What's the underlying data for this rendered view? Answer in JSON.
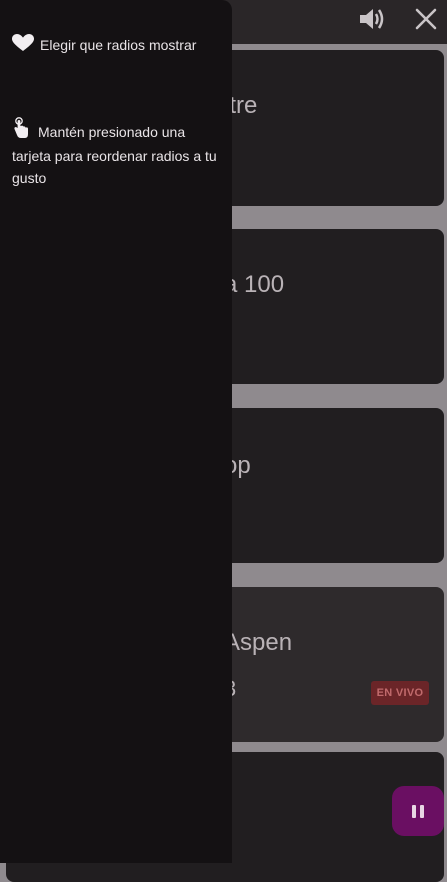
{
  "topbar": {
    "volume_icon": "volume-up-icon",
    "close_icon": "close-icon"
  },
  "cards": [
    {
      "title": "itre"
    },
    {
      "title": "a 100"
    },
    {
      "title": "op"
    },
    {
      "title": "Aspen",
      "subtitle": "3",
      "badge": "EN VIVO"
    },
    {
      "title": ""
    }
  ],
  "player": {
    "pause_icon": "pause-icon"
  },
  "drawer": {
    "items": [
      {
        "icon": "heart-icon",
        "label": "Elegir que radios mostrar"
      },
      {
        "icon": "touch-hand-icon",
        "label": "Mantén presionado una tarjeta para reordenar radios a tu gusto"
      }
    ]
  },
  "colors": {
    "accent": "#6a0f62",
    "live_badge_bg": "#6b2528",
    "drawer_bg": "#141113"
  }
}
